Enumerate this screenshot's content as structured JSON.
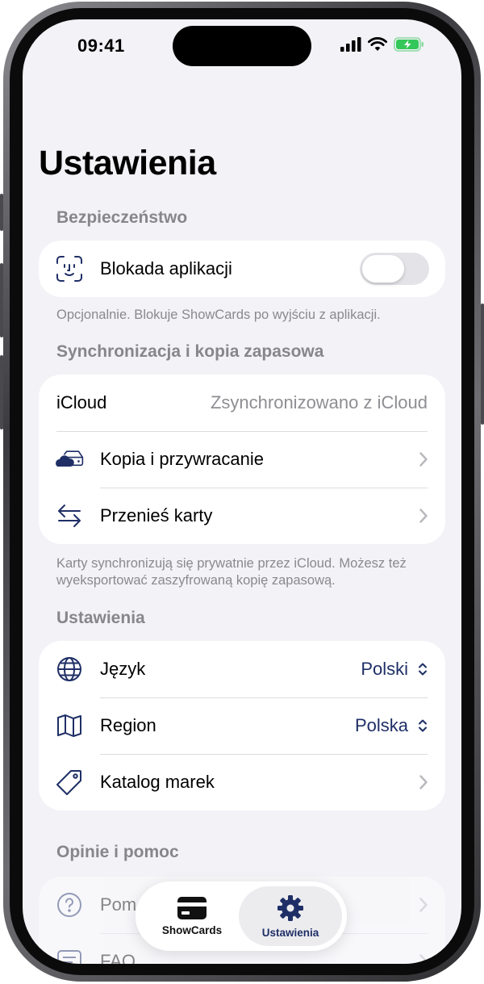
{
  "status": {
    "time": "09:41"
  },
  "page": {
    "title": "Ustawienia"
  },
  "security": {
    "header": "Bezpieczeństwo",
    "app_lock_label": "Blokada aplikacji",
    "app_lock_enabled": false,
    "footnote": "Opcjonalnie. Blokuje ShowCards po wyjściu z aplikacji."
  },
  "sync": {
    "header": "Synchronizacja i kopia zapasowa",
    "icloud_label": "iCloud",
    "icloud_status": "Zsynchronizowano z iCloud",
    "backup_label": "Kopia i przywracanie",
    "transfer_label": "Przenieś karty",
    "footnote": "Karty synchronizują się prywatnie przez iCloud. Możesz też wyeksportować zaszyfrowaną kopię zapasową."
  },
  "settings": {
    "header": "Ustawienia",
    "language_label": "Język",
    "language_value": "Polski",
    "region_label": "Region",
    "region_value": "Polska",
    "catalog_label": "Katalog marek"
  },
  "feedback": {
    "header": "Opinie i pomoc",
    "help_label": "Pom",
    "faq_label": "FAQ"
  },
  "tabbar": {
    "tabs": [
      {
        "label": "ShowCards",
        "icon": "card-icon"
      },
      {
        "label": "Ustawienia",
        "icon": "gear-icon"
      }
    ],
    "active": "Ustawienia"
  },
  "colors": {
    "accent": "#1f2f66",
    "background": "#f2f2f7",
    "secondary_text": "#8e8e93",
    "battery": "#34c759"
  }
}
